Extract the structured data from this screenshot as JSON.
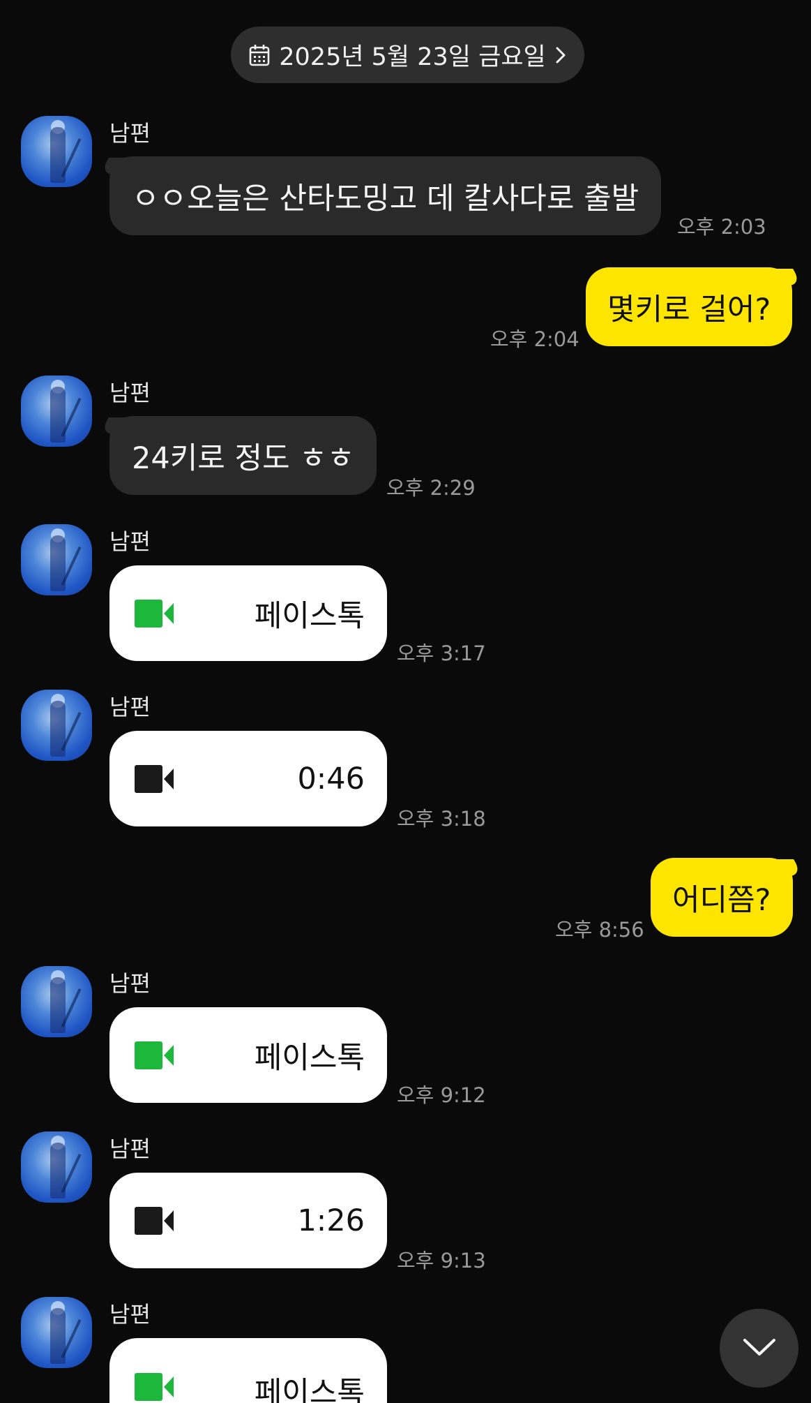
{
  "date_header": {
    "label": "2025년 5월 23일 금요일",
    "icon": "calendar-icon",
    "chevron": "chevron-right-icon"
  },
  "contact": {
    "name": "남편"
  },
  "messages": [
    {
      "type": "text",
      "from": "남편",
      "text": "ㅇㅇ오늘은 산타도밍고 데 칼사다로 출발",
      "time": "오후 2:03"
    },
    {
      "type": "text",
      "from": "me",
      "text": "몇키로 걸어?",
      "time": "오후 2:04"
    },
    {
      "type": "text",
      "from": "남편",
      "text": "24키로 정도 ㅎㅎ",
      "time": "오후 2:29"
    },
    {
      "type": "call",
      "from": "남편",
      "label": "페이스톡",
      "icon": "video-camera-icon",
      "icon_color": "#1db83b",
      "time": "오후 3:17"
    },
    {
      "type": "call",
      "from": "남편",
      "label": "0:46",
      "icon": "video-camera-icon",
      "icon_color": "#1a1a1a",
      "time": "오후 3:18"
    },
    {
      "type": "text",
      "from": "me",
      "text": "어디쯤?",
      "time": "오후 8:56"
    },
    {
      "type": "call",
      "from": "남편",
      "label": "페이스톡",
      "icon": "video-camera-icon",
      "icon_color": "#1db83b",
      "time": "오후 9:12"
    },
    {
      "type": "call",
      "from": "남편",
      "label": "1:26",
      "icon": "video-camera-icon",
      "icon_color": "#1a1a1a",
      "time": "오후 9:13"
    },
    {
      "type": "call",
      "from": "남편",
      "label": "페이스톡",
      "icon": "video-camera-icon",
      "icon_color": "#1db83b",
      "time": ""
    }
  ],
  "scroll_button": {
    "icon": "chevron-down-icon"
  },
  "colors": {
    "background": "#0a0a0a",
    "incoming_bubble": "#2a2a2a",
    "outgoing_bubble": "#fde500",
    "call_bubble": "#ffffff",
    "timestamp": "#9a9a9a"
  }
}
